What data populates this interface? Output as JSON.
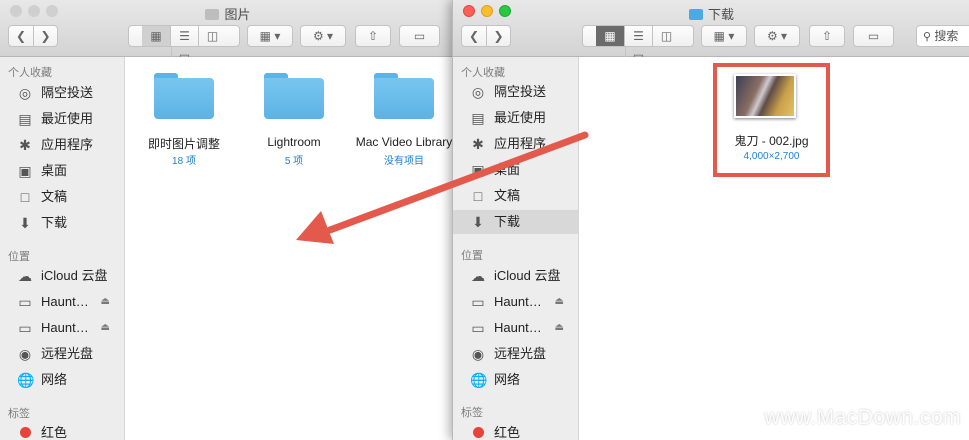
{
  "left_window": {
    "title": "图片",
    "sidebar": {
      "favorites_header": "个人收藏",
      "favorites": [
        {
          "icon": "airdrop-icon",
          "label": "隔空投送"
        },
        {
          "icon": "recents-icon",
          "label": "最近使用"
        },
        {
          "icon": "applications-icon",
          "label": "应用程序"
        },
        {
          "icon": "desktop-icon",
          "label": "桌面"
        },
        {
          "icon": "documents-icon",
          "label": "文稿"
        },
        {
          "icon": "downloads-icon",
          "label": "下载"
        }
      ],
      "locations_header": "位置",
      "locations": [
        {
          "icon": "icloud-icon",
          "label": "iCloud 云盘"
        },
        {
          "icon": "disk-icon",
          "label": "Haunt…"
        },
        {
          "icon": "disk-icon",
          "label": "Haunt…"
        },
        {
          "icon": "remote-disc-icon",
          "label": "远程光盘"
        },
        {
          "icon": "network-icon",
          "label": "网络"
        }
      ],
      "tags_header": "标签",
      "tags": [
        {
          "label": "红色",
          "color": "#e8423b"
        }
      ]
    },
    "folders": [
      {
        "name": "即时图片调整",
        "sub": "18 项"
      },
      {
        "name": "Lightroom",
        "sub": "5 项"
      },
      {
        "name": "Mac Video Library",
        "sub": "没有项目"
      }
    ]
  },
  "right_window": {
    "title": "下载",
    "search_placeholder": "搜索",
    "sidebar": {
      "favorites_header": "个人收藏",
      "favorites": [
        {
          "icon": "airdrop-icon",
          "label": "隔空投送"
        },
        {
          "icon": "recents-icon",
          "label": "最近使用"
        },
        {
          "icon": "applications-icon",
          "label": "应用程序"
        },
        {
          "icon": "desktop-icon",
          "label": "桌面"
        },
        {
          "icon": "documents-icon",
          "label": "文稿"
        },
        {
          "icon": "downloads-icon",
          "label": "下载",
          "selected": true
        }
      ],
      "locations_header": "位置",
      "locations": [
        {
          "icon": "icloud-icon",
          "label": "iCloud 云盘"
        },
        {
          "icon": "disk-icon",
          "label": "Haunt…"
        },
        {
          "icon": "disk-icon",
          "label": "Haunt…"
        },
        {
          "icon": "remote-disc-icon",
          "label": "远程光盘"
        },
        {
          "icon": "network-icon",
          "label": "网络"
        }
      ],
      "tags_header": "标签",
      "tags": [
        {
          "label": "红色",
          "color": "#e8423b"
        }
      ]
    },
    "file": {
      "name": "鬼刀 - 002.jpg",
      "dimensions": "4,000×2,700"
    }
  },
  "watermark": "www.MacDown.com",
  "colors": {
    "annotation": "#e35a4c",
    "folder": "#6bbcea",
    "sub_text": "#1c7ed6",
    "selected_tab": "#6b6b6b"
  }
}
